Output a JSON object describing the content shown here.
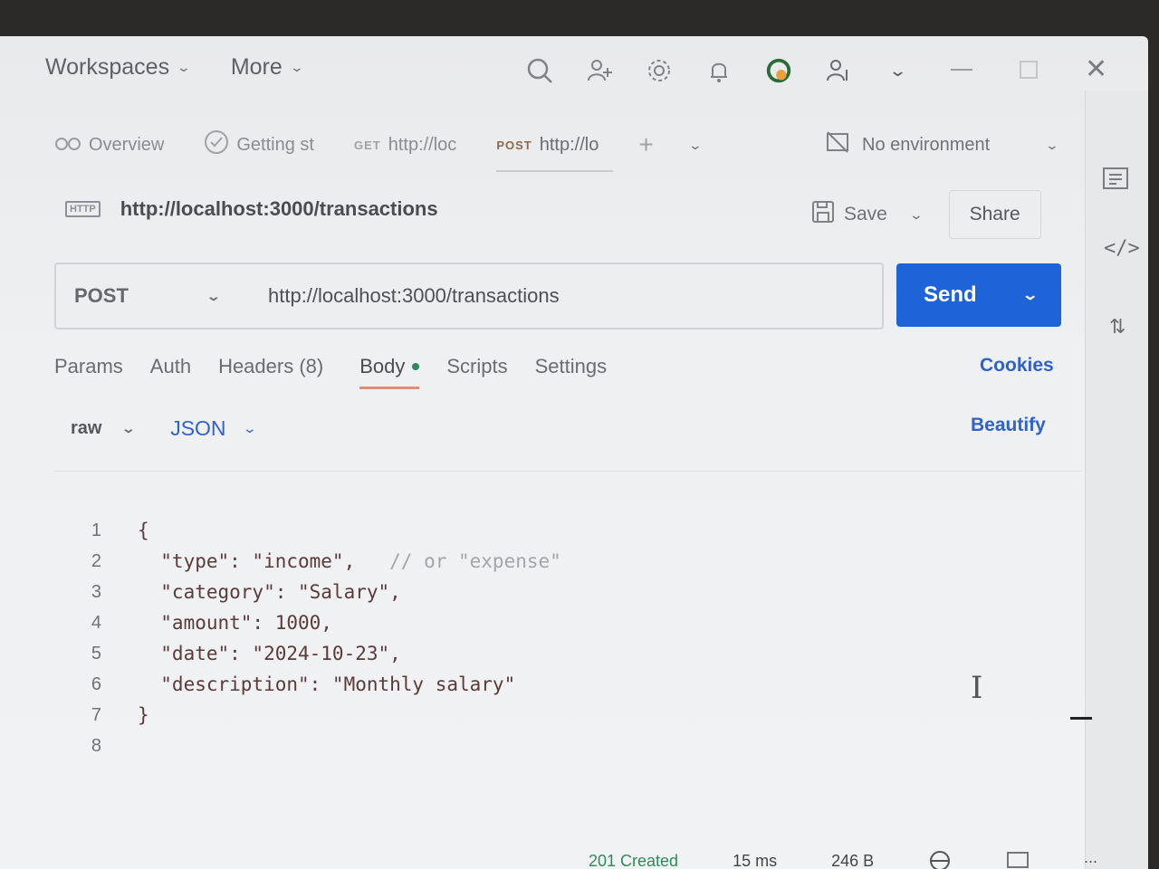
{
  "titlebar": {
    "menus": [
      {
        "label": "Workspaces"
      },
      {
        "label": "More"
      }
    ]
  },
  "tabs": [
    {
      "method": "",
      "label": "Overview",
      "icon": "overview-icon"
    },
    {
      "method": "",
      "label": "Getting st",
      "icon": "check-circle-icon"
    },
    {
      "method": "GET",
      "label": "http://loc"
    },
    {
      "method": "POST",
      "label": "http://lo",
      "active": true
    }
  ],
  "environment": {
    "label": "No environment"
  },
  "request": {
    "title": "http://localhost:3000/transactions",
    "save_label": "Save",
    "share_label": "Share",
    "method": "POST",
    "url": "http://localhost:3000/transactions",
    "send_label": "Send"
  },
  "subtabs": [
    {
      "label": "Params"
    },
    {
      "label": "Auth"
    },
    {
      "label": "Headers (8)"
    },
    {
      "label": "Body",
      "active": true
    },
    {
      "label": "Scripts"
    },
    {
      "label": "Settings"
    }
  ],
  "cookies_label": "Cookies",
  "body": {
    "mode": "raw",
    "format": "JSON",
    "beautify_label": "Beautify",
    "lines": [
      {
        "n": "1",
        "code": "{",
        "comment": ""
      },
      {
        "n": "2",
        "code": "  \"type\": \"income\",",
        "comment": "   // or \"expense\""
      },
      {
        "n": "3",
        "code": "  \"category\": \"Salary\",",
        "comment": ""
      },
      {
        "n": "4",
        "code": "  \"amount\": 1000,",
        "comment": ""
      },
      {
        "n": "5",
        "code": "  \"date\": \"2024-10-23\",",
        "comment": ""
      },
      {
        "n": "6",
        "code": "  \"description\": \"Monthly salary\"",
        "comment": ""
      },
      {
        "n": "7",
        "code": "}",
        "comment": ""
      },
      {
        "n": "8",
        "code": "",
        "comment": ""
      }
    ]
  },
  "status": {
    "code": "201 Created",
    "time": "15 ms",
    "size": "246 B"
  },
  "colors": {
    "send": "#1e63d8",
    "link": "#3162c9",
    "active_underline": "#e28d7c",
    "body_dot": "#2e8a5a"
  }
}
